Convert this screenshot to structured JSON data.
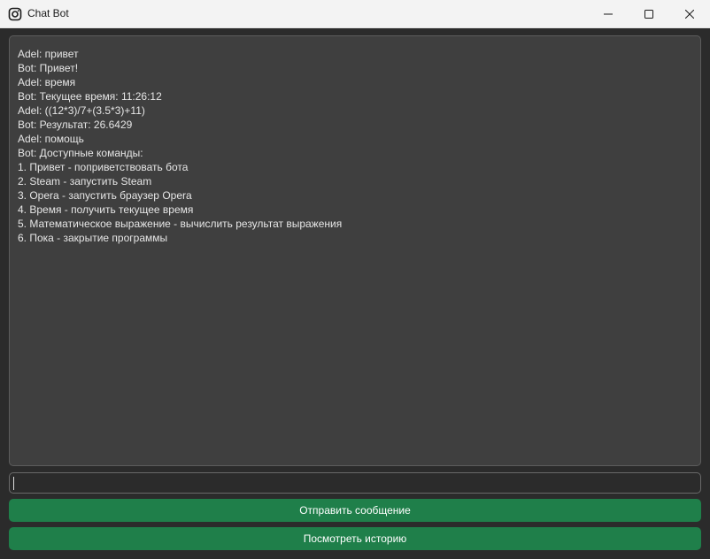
{
  "window": {
    "title": "Chat Bot",
    "icon": "instagram-icon"
  },
  "window_controls": {
    "minimize": "minimize-icon",
    "maximize": "maximize-icon",
    "close": "close-icon"
  },
  "chat": {
    "lines": [
      "Adel: привет",
      "Bot: Привет!",
      "Adel: время",
      "Bot: Текущее время: 11:26:12",
      "Adel: ((12*3)/7+(3.5*3)+11)",
      "Bot: Результат: 26.6429",
      "Adel: помощь",
      "Bot: Доступные команды:",
      "1. Привет - поприветствовать бота",
      "2. Steam - запустить Steam",
      "3. Opera - запустить браузер Opera",
      "4. Время - получить текущее время",
      "5. Математическое выражение - вычислить результат выражения",
      "6. Пока - закрытие программы"
    ]
  },
  "input": {
    "value": ""
  },
  "buttons": {
    "send_label": "Отправить сообщение",
    "history_label": "Посмотреть историю"
  },
  "colors": {
    "accent": "#1f7f4a",
    "background": "#2b2b2b",
    "chat_background": "#3f3f3f",
    "titlebar": "#f3f3f3"
  }
}
